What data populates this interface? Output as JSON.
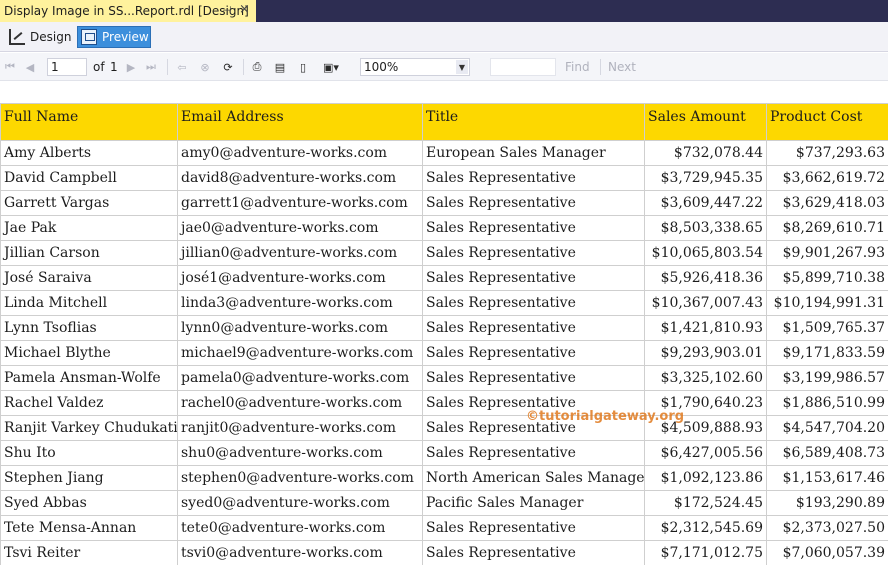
{
  "document_tab": {
    "title": "Display Image in SS...Report.rdl [Design]",
    "pin": "⊣",
    "close": "×"
  },
  "view_tabs": {
    "design_label": "Design",
    "preview_label": "Preview"
  },
  "toolbar": {
    "current_page": "1",
    "of_label": "of",
    "total_pages": "1",
    "zoom": "100%",
    "find_label": "Find",
    "next_label": "Next"
  },
  "table": {
    "headers": [
      "Full Name",
      "Email Address",
      "Title",
      "Sales Amount",
      "Product Cost"
    ],
    "rows": [
      [
        "Amy Alberts",
        "amy0@adventure-works.com",
        "European Sales Manager",
        "$732,078.44",
        "$737,293.63"
      ],
      [
        "David Campbell",
        "david8@adventure-works.com",
        "Sales Representative",
        "$3,729,945.35",
        "$3,662,619.72"
      ],
      [
        "Garrett Vargas",
        "garrett1@adventure-works.com",
        "Sales Representative",
        "$3,609,447.22",
        "$3,629,418.03"
      ],
      [
        "Jae Pak",
        "jae0@adventure-works.com",
        "Sales Representative",
        "$8,503,338.65",
        "$8,269,610.71"
      ],
      [
        "Jillian Carson",
        "jillian0@adventure-works.com",
        "Sales Representative",
        "$10,065,803.54",
        "$9,901,267.93"
      ],
      [
        "José Saraiva",
        "josé1@adventure-works.com",
        "Sales Representative",
        "$5,926,418.36",
        "$5,899,710.38"
      ],
      [
        "Linda Mitchell",
        "linda3@adventure-works.com",
        "Sales Representative",
        "$10,367,007.43",
        "$10,194,991.31"
      ],
      [
        "Lynn Tsoflias",
        "lynn0@adventure-works.com",
        "Sales Representative",
        "$1,421,810.93",
        "$1,509,765.37"
      ],
      [
        "Michael Blythe",
        "michael9@adventure-works.com",
        "Sales Representative",
        "$9,293,903.01",
        "$9,171,833.59"
      ],
      [
        "Pamela Ansman-Wolfe",
        "pamela0@adventure-works.com",
        "Sales Representative",
        "$3,325,102.60",
        "$3,199,986.57"
      ],
      [
        "Rachel Valdez",
        "rachel0@adventure-works.com",
        "Sales Representative",
        "$1,790,640.23",
        "$1,886,510.99"
      ],
      [
        "Ranjit Varkey Chudukatil",
        "ranjit0@adventure-works.com",
        "Sales Representative",
        "$4,509,888.93",
        "$4,547,704.20"
      ],
      [
        "Shu Ito",
        "shu0@adventure-works.com",
        "Sales Representative",
        "$6,427,005.56",
        "$6,589,408.73"
      ],
      [
        "Stephen Jiang",
        "stephen0@adventure-works.com",
        "North American Sales Manager",
        "$1,092,123.86",
        "$1,153,617.46"
      ],
      [
        "Syed Abbas",
        "syed0@adventure-works.com",
        "Pacific Sales Manager",
        "$172,524.45",
        "$193,290.89"
      ],
      [
        "Tete Mensa-Annan",
        "tete0@adventure-works.com",
        "Sales Representative",
        "$2,312,545.69",
        "$2,373,027.50"
      ],
      [
        "Tsvi Reiter",
        "tsvi0@adventure-works.com",
        "Sales Representative",
        "$7,171,012.75",
        "$7,060,057.39"
      ]
    ]
  },
  "watermark": "©tutorialgateway.org",
  "colors": {
    "header_fill": "#fdd800",
    "preview_tab": "#3c8fdc",
    "doc_tab": "#fff29d",
    "tab_strip": "#2d2d52"
  }
}
